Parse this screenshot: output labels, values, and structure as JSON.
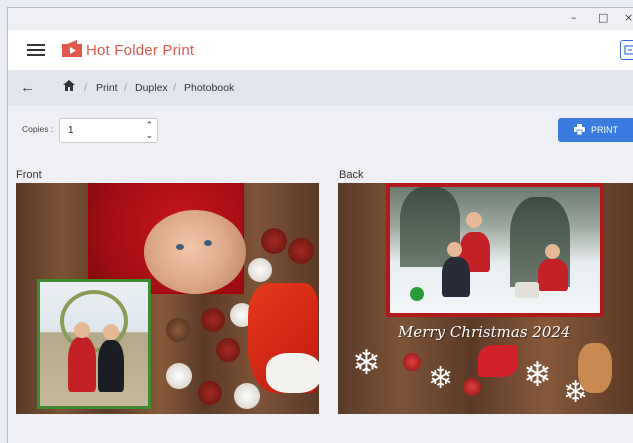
{
  "window": {
    "minimize": "–",
    "maximize": "□",
    "close": "×"
  },
  "app": {
    "name": "Hot Folder Print"
  },
  "breadcrumb": [
    "Print",
    "Duplex",
    "Photobook"
  ],
  "copies": {
    "label": "Copies :",
    "value": "1"
  },
  "print_button": {
    "label": "PRINT"
  },
  "panels": {
    "front": "Front",
    "back": "Back"
  },
  "back_image_text": "Merry Christmas 2024",
  "colors": {
    "accent": "#3a7be0",
    "brand": "#e0584e"
  }
}
